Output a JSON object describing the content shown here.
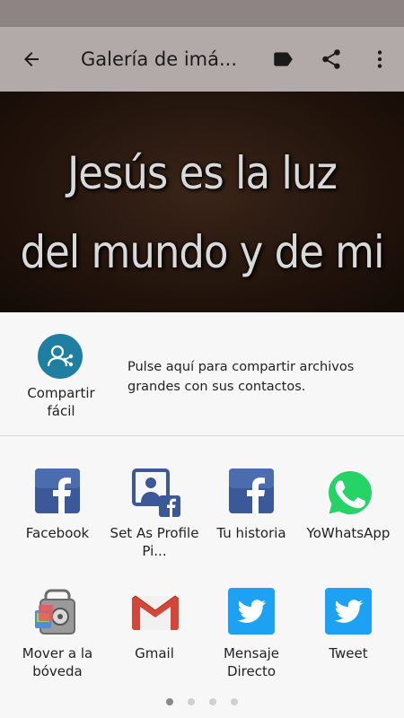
{
  "app_bar": {
    "title": "Galería de imá...",
    "back_icon": "arrow-back-icon",
    "tag_icon": "label-icon",
    "share_icon": "share-icon",
    "more_icon": "more-vert-icon"
  },
  "hero": {
    "line1": "Jesús es la luz",
    "line2": "del mundo y de mi"
  },
  "share_sheet": {
    "easy_share": {
      "label": "Compartir fácil",
      "description": "Pulse aquí para compartir archivos grandes con sus contactos."
    },
    "apps": [
      {
        "label": "Facebook",
        "icon": "facebook-icon"
      },
      {
        "label": "Set As Profile Pi...",
        "icon": "set-profile-picture-icon"
      },
      {
        "label": "Tu historia",
        "icon": "facebook-story-icon"
      },
      {
        "label": "YoWhatsApp",
        "icon": "whatsapp-icon"
      },
      {
        "label": "Mover a la bóveda",
        "icon": "vault-icon"
      },
      {
        "label": "Gmail",
        "icon": "gmail-icon"
      },
      {
        "label": "Mensaje Directo",
        "icon": "twitter-dm-icon"
      },
      {
        "label": "Tweet",
        "icon": "twitter-icon"
      }
    ],
    "page_count": 4,
    "current_page": 1
  },
  "colors": {
    "status_bar": "#8e8484",
    "app_bar": "#b2a9a9",
    "facebook": "#3b5998",
    "twitter": "#1da1f2",
    "whatsapp": "#25d366",
    "gmail_red": "#d44638",
    "easy_share": "#1f7fa3"
  }
}
